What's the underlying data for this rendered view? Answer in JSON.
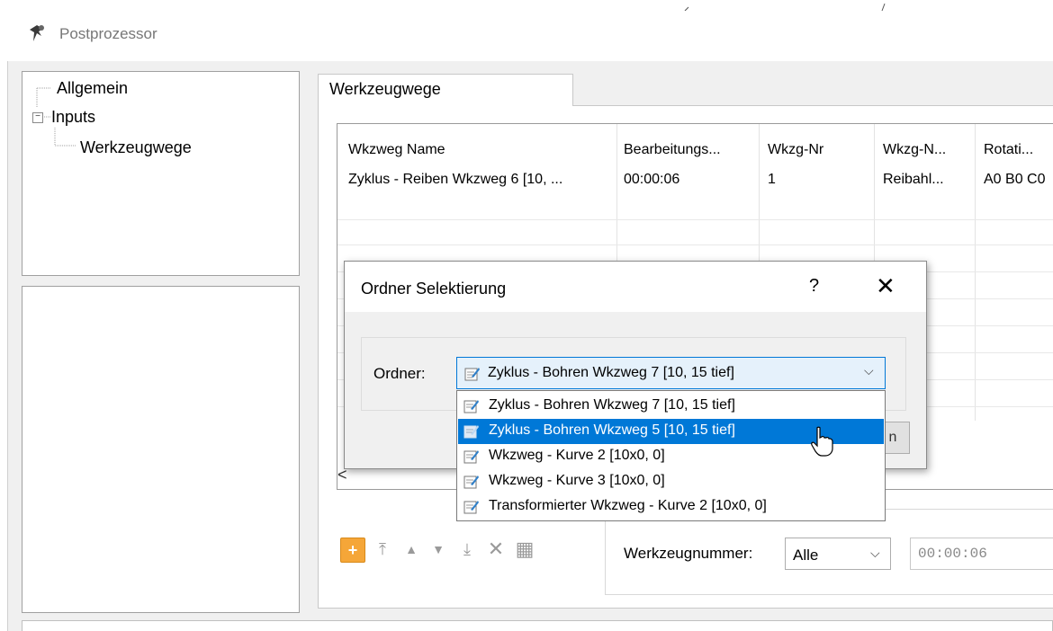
{
  "window": {
    "title": "Postprozessor",
    "icon": "gear-pin-icon"
  },
  "tree": {
    "items": [
      {
        "label": "Allgemein",
        "level": 0,
        "expander": ""
      },
      {
        "label": "Inputs",
        "level": 0,
        "expander": "−"
      },
      {
        "label": "Werkzeugwege",
        "level": 1,
        "expander": "",
        "selected": true
      }
    ]
  },
  "tab": {
    "label": "Werkzeugwege"
  },
  "grid": {
    "columns": [
      "Wkzweg Name",
      "Bearbeitungs...",
      "Wkzg-Nr",
      "Wkzg-N...",
      "Rotati..."
    ],
    "rows": [
      [
        "Zyklus - Reiben Wkzweg 6 [10, ...",
        "00:00:06",
        "1",
        "Reibahl...",
        "A0 B0 C0"
      ]
    ],
    "scroll_left": "<"
  },
  "dialog": {
    "title": "Ordner Selektierung",
    "help": "?",
    "close": "✕",
    "label": "Ordner:",
    "selected": "Zyklus - Bohren Wkzweg 7 [10, 15 tief]",
    "arrow": "⌵",
    "button_fragment": "n",
    "options": [
      "Zyklus - Bohren Wkzweg 7 [10, 15 tief]",
      "Zyklus - Bohren Wkzweg 5 [10, 15 tief]",
      "Wkzweg - Kurve 2 [10x0, 0]",
      "Wkzweg - Kurve 3 [10x0, 0]",
      "Transformierter Wkzweg - Kurve 2 [10x0, 0]"
    ],
    "highlighted_index": 1
  },
  "toolbar": {
    "add": "+",
    "move_top": "⤒",
    "move_up": "▲",
    "move_down": "▼",
    "move_bottom": "⤓",
    "delete": "✕",
    "table": "▦"
  },
  "filter": {
    "label": "Werkzeugnummer:",
    "value": "Alle",
    "arrow": "⌵",
    "time": "00:00:06"
  },
  "colors": {
    "accent": "#0078d7",
    "add_button": "#f5a638",
    "frame": "#f0f0f0"
  }
}
